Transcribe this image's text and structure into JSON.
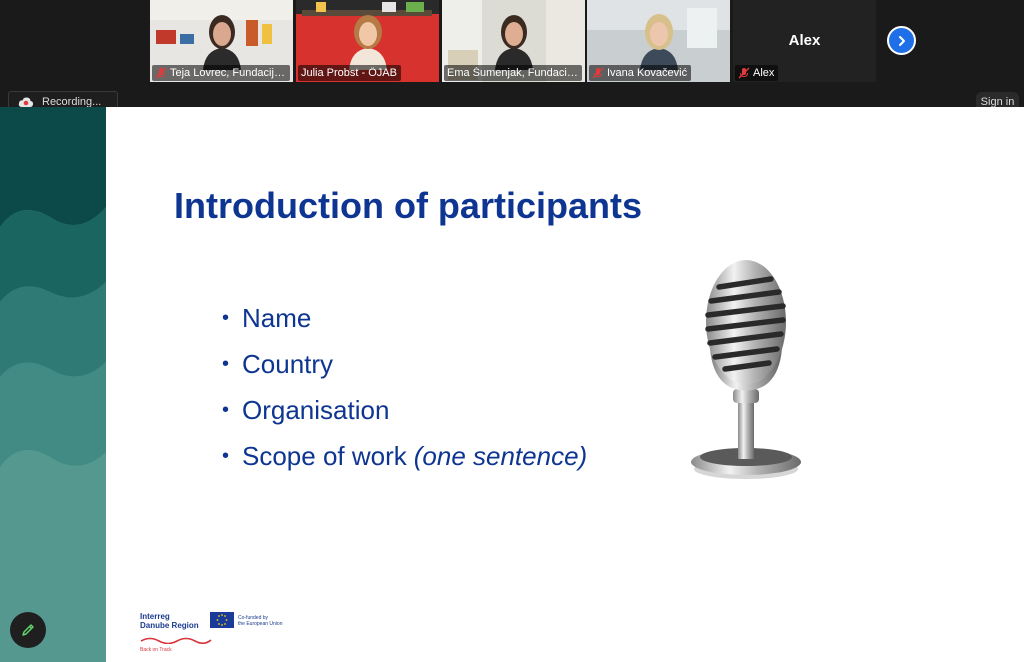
{
  "participants": [
    {
      "name": "Teja Lovrec, Fundacija ...",
      "muted": true
    },
    {
      "name": "Julia Probst - ÖJAB",
      "muted": false
    },
    {
      "name": "Ema Šumenjak, Fundacija ...",
      "muted": false,
      "speaking": true
    },
    {
      "name": "Ivana Kovačević",
      "muted": true
    },
    {
      "name": "Alex",
      "display_text": "Alex",
      "muted": true,
      "video": false
    }
  ],
  "controls": {
    "recording_label": "Recording...",
    "signin_label": "Sign in"
  },
  "slide": {
    "title": "Introduction of participants",
    "bullets": [
      "Name",
      "Country",
      "Organisation",
      "Scope of work"
    ],
    "bullet_note": "(one sentence)",
    "logos": {
      "program_line1": "Interreg",
      "program_line2": "Danube Region",
      "cofund_line1": "Co-funded by",
      "cofund_line2": "the European Union",
      "project": "Back on Track"
    }
  },
  "colors": {
    "title_blue": "#0d3591",
    "speaking_border": "#9bd24a",
    "next_button": "#1f6fe8",
    "side_wave_dark": "#0b4a48",
    "side_wave_light": "#4f958e"
  },
  "icons": [
    "mic-off-icon",
    "chevron-right-icon",
    "cloud-record-icon",
    "pencil-icon",
    "microphone-image"
  ]
}
